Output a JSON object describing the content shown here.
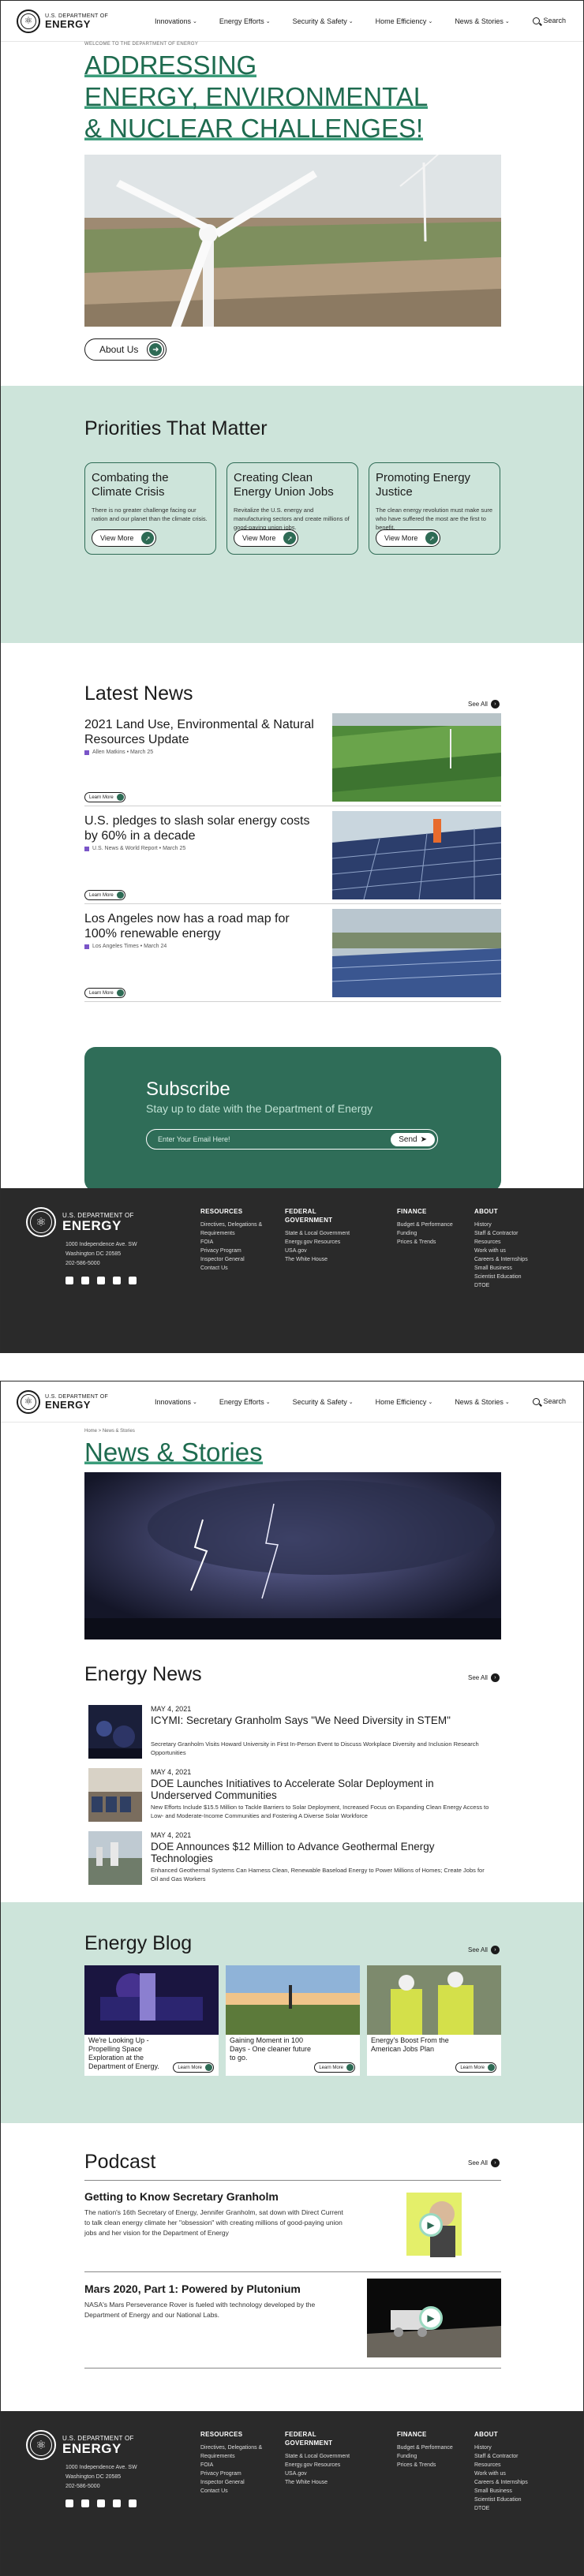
{
  "header": {
    "brand_top": "U.S. DEPARTMENT OF",
    "brand_main": "ENERGY",
    "nav": [
      "Innovations",
      "Energy Efforts",
      "Security & Safety",
      "Home Efficiency",
      "News & Stories"
    ],
    "search_label": "Search"
  },
  "home": {
    "welcome_label": "WELCOME TO THE DEPARTMENT OF ENERGY",
    "hero_lines": [
      "ADDRESSING",
      "ENERGY, ENVIRONMENTAL",
      "& NUCLEAR CHALLENGES!"
    ],
    "about_button": "About Us",
    "priorities_title": "Priorities That Matter",
    "priorities": [
      {
        "title": "Combating the Climate Crisis",
        "text": "There is no greater challenge facing our nation and our planet than the climate crisis.",
        "button": "View More"
      },
      {
        "title": "Creating Clean Energy Union Jobs",
        "text": "Revitalize the U.S. energy and manufacturing sectors and create millions of good-paying union jobs.",
        "button": "View More"
      },
      {
        "title": "Promoting Energy Justice",
        "text": "The clean energy revolution must make sure who have suffered the most are the first to benefit.",
        "button": "View More"
      }
    ],
    "latest_news_title": "Latest News",
    "see_all": "See All",
    "news": [
      {
        "title": "2021 Land Use, Environmental & Natural Resources Update",
        "meta": "Allen Matkins • March 25",
        "button": "Learn More"
      },
      {
        "title": "U.S. pledges to slash solar energy costs by 60% in a decade",
        "meta": "U.S. News & World Report • March 25",
        "button": "Learn More"
      },
      {
        "title": "Los Angeles now has a road map for 100% renewable energy",
        "meta": "Los Angeles Times • March 24",
        "button": "Learn More"
      }
    ],
    "subscribe": {
      "title": "Subscribe",
      "subtitle": "Stay up to date with the Department of Energy",
      "placeholder": "Enter Your Email Here!",
      "button": "Send"
    }
  },
  "footer": {
    "address": [
      "1000 Independence Ave. SW",
      "Washington DC 20585",
      "202-586-5000"
    ],
    "columns": [
      {
        "heading": "RESOURCES",
        "items": [
          "Directives, Delegations & Requirements",
          "FOIA",
          "Privacy Program",
          "Inspector General",
          "Contact Us"
        ]
      },
      {
        "heading": "FEDERAL GOVERNMENT",
        "items": [
          "State & Local Government",
          "Energy.gov Resources",
          "USA.gov",
          "The White House"
        ]
      },
      {
        "heading": "FINANCE",
        "items": [
          "Budget & Performance",
          "Funding",
          "Prices & Trends"
        ]
      },
      {
        "heading": "ABOUT",
        "items": [
          "History",
          "Staff & Contractor Resources",
          "Work with us",
          "Careers & Internships",
          "Small Business",
          "Scientist Education",
          "DTOE"
        ]
      }
    ]
  },
  "news_page": {
    "breadcrumb": "Home > News & Stories",
    "title": "News & Stories",
    "energy_news_title": "Energy News",
    "see_all": "See All",
    "energy_news": [
      {
        "date": "MAY 4, 2021",
        "title": "ICYMI: Secretary Granholm Says \"We Need Diversity in STEM\"",
        "desc": "Secretary Granholm Visits Howard University in First In-Person Event to Discuss Workplace Diversity and Inclusion Research Opportunities"
      },
      {
        "date": "MAY 4, 2021",
        "title": "DOE Launches Initiatives to Accelerate Solar Deployment in Underserved Communities",
        "desc": "New Efforts Include $15.5 Million to Tackle Barriers to Solar Deployment, Increased Focus on Expanding Clean Energy Access to Low- and Moderate-Income Communities and Fostering A Diverse Solar Workforce"
      },
      {
        "date": "MAY 4, 2021",
        "title": "DOE Announces $12 Million to Advance Geothermal Energy Technologies",
        "desc": "Enhanced Geothermal Systems Can Harness Clean, Renewable Baseload Energy to Power Millions of Homes; Create Jobs for Oil and Gas Workers"
      }
    ],
    "blog_title": "Energy Blog",
    "blog": [
      {
        "title": "We're Looking Up - Propelling Space Exploration at the Department of Energy.",
        "button": "Learn More"
      },
      {
        "title": "Gaining Moment in 100 Days - One cleaner future to go.",
        "button": "Learn More"
      },
      {
        "title": "Energy's Boost From the American Jobs Plan",
        "button": "Learn More"
      }
    ],
    "podcast_title": "Podcast",
    "podcasts": [
      {
        "title": "Getting to Know Secretary Granholm",
        "desc": "The nation's 16th Secretary of Energy, Jennifer Granholm, sat down with Direct Current to talk clean energy climate her \"obsession\" with creating millions of good-paying union jobs and her vision for the Department of Energy"
      },
      {
        "title": "Mars 2020, Part 1: Powered by Plutonium",
        "desc": "NASA's Mars Perseverance Rover is fueled with technology developed by the Department of Energy and our National Labs."
      }
    ]
  }
}
